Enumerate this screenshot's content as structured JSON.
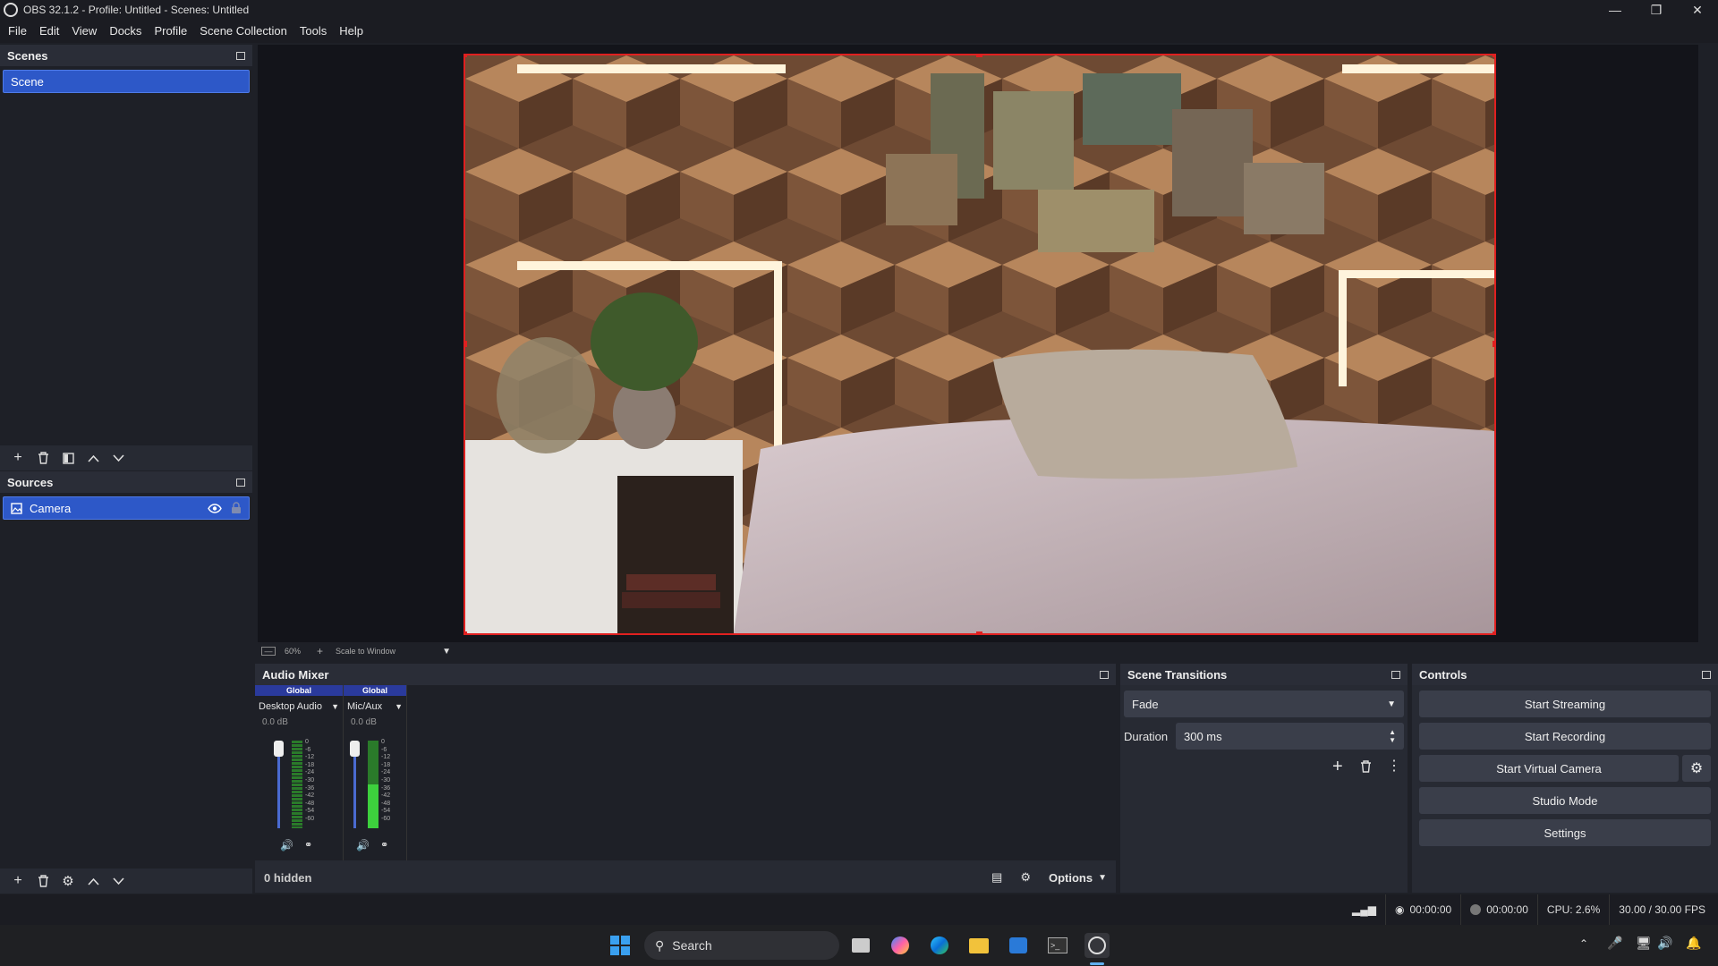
{
  "window": {
    "title": "OBS 32.1.2 - Profile: Untitled - Scenes: Untitled"
  },
  "menu": [
    "File",
    "Edit",
    "View",
    "Docks",
    "Profile",
    "Scene Collection",
    "Tools",
    "Help"
  ],
  "scenes": {
    "title": "Scenes",
    "items": [
      "Scene"
    ]
  },
  "sources": {
    "title": "Sources",
    "items": [
      "Camera"
    ]
  },
  "preview": {
    "zoom": "60%",
    "scale_mode": "Scale to Window"
  },
  "audio_mixer": {
    "title": "Audio Mixer",
    "channels": [
      {
        "badge": "Global",
        "name": "Desktop Audio",
        "level": "0.0 dB"
      },
      {
        "badge": "Global",
        "name": "Mic/Aux",
        "level": "0.0 dB"
      }
    ],
    "scale": [
      "0",
      "-6",
      "-12",
      "-18",
      "-24",
      "-30",
      "-36",
      "-42",
      "-48",
      "-54",
      "-60"
    ],
    "hidden_label": "0 hidden",
    "options_label": "Options"
  },
  "transitions": {
    "title": "Scene Transitions",
    "selected": "Fade",
    "duration_label": "Duration",
    "duration_value": "300 ms"
  },
  "controls": {
    "title": "Controls",
    "start_streaming": "Start Streaming",
    "start_recording": "Start Recording",
    "start_virtual_camera": "Start Virtual Camera",
    "studio_mode": "Studio Mode",
    "settings": "Settings"
  },
  "status": {
    "stream_time": "00:00:00",
    "record_time": "00:00:00",
    "cpu": "CPU: 2.6%",
    "fps": "30.00 / 30.00 FPS"
  },
  "taskbar": {
    "search_placeholder": "Search"
  }
}
